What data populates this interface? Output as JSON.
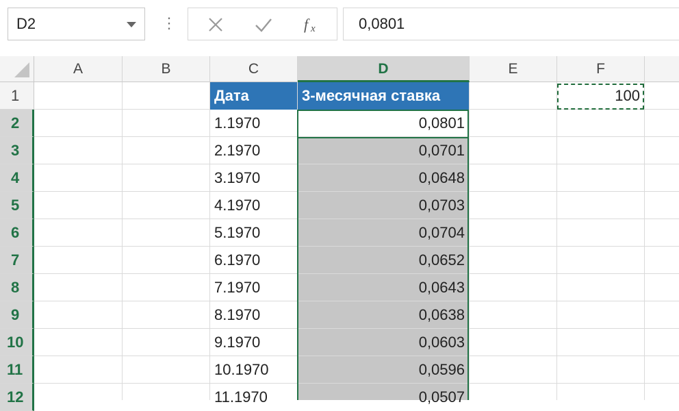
{
  "formula_bar": {
    "name_box": "D2",
    "more_icon": "⋮",
    "cancel_icon": "close-icon",
    "enter_icon": "check-icon",
    "function_icon": "fx-icon",
    "formula_value": "0,0801"
  },
  "columns": [
    "A",
    "B",
    "C",
    "D",
    "E",
    "F"
  ],
  "selected_column": "D",
  "rows": [
    "1",
    "2",
    "3",
    "4",
    "5",
    "6",
    "7",
    "8",
    "9",
    "10",
    "11",
    "12"
  ],
  "table": {
    "header_date": "Дата",
    "header_rate": "3-месячная ставка",
    "dates": [
      "1.1970",
      "2.1970",
      "3.1970",
      "4.1970",
      "5.1970",
      "6.1970",
      "7.1970",
      "8.1970",
      "9.1970",
      "10.1970",
      "11.1970"
    ],
    "rates": [
      "0,0801",
      "0,0701",
      "0,0648",
      "0,0703",
      "0,0704",
      "0,0652",
      "0,0643",
      "0,0638",
      "0,0603",
      "0,0596",
      "0,0507"
    ]
  },
  "cell_f1": "100",
  "colors": {
    "header_fill": "#2e75b6",
    "selection_green": "#217346",
    "selection_fill": "#c6c6c6"
  }
}
